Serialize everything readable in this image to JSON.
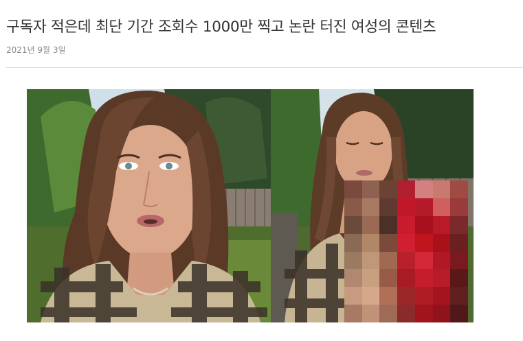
{
  "article": {
    "title": "구독자 적은데 최단 기간 조회수 1000만 찍고 논란 터진 여성의 콘텐츠",
    "date": "2021년 9월 3일"
  },
  "mosaic_colors": [
    "#7a4a3e",
    "#8f6150",
    "#6b4335",
    "#b02030",
    "#d58080",
    "#c97a70",
    "#a04a44",
    "#8a5a48",
    "#a87a62",
    "#5e3a30",
    "#c01828",
    "#b51a2a",
    "#d06060",
    "#9a3a3a",
    "#6a4a3a",
    "#9a6a55",
    "#4a3028",
    "#c81c2c",
    "#a8101e",
    "#b81a28",
    "#7a2a2a",
    "#8a6a55",
    "#b08868",
    "#7a4a3a",
    "#d02030",
    "#c0141f",
    "#a8101a",
    "#6a2020",
    "#9a7a60",
    "#c09878",
    "#a06a50",
    "#b8202c",
    "#d42838",
    "#b01828",
    "#7a1a1e",
    "#b08870",
    "#c8a080",
    "#9a5a48",
    "#a81a24",
    "#c41e2c",
    "#b81c28",
    "#5a1818",
    "#c89a80",
    "#d4a888",
    "#b07058",
    "#9a2828",
    "#b01c24",
    "#a41420",
    "#602020",
    "#a87a66",
    "#c29278",
    "#a06a58",
    "#8a2a2a",
    "#a0141c",
    "#90121a",
    "#501818"
  ]
}
